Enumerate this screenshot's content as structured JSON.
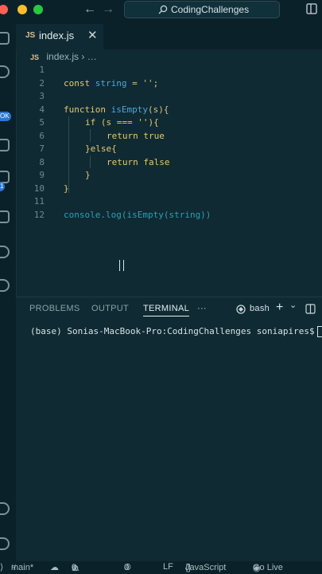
{
  "titlebar": {
    "back_icon": "arrow-left-icon",
    "forward_icon": "arrow-right-icon",
    "command_center_label": "CodingChallenges",
    "traffic_lights": [
      "#fe5f57",
      "#febc2e",
      "#28c840"
    ]
  },
  "activity_bar": {
    "badges": [
      "OK",
      "1"
    ]
  },
  "tab": {
    "lang_badge": "JS",
    "filename": "index.js",
    "close_glyph": "✕"
  },
  "breadcrumb": {
    "lang_badge": "JS",
    "file": "index.js",
    "separator": "›",
    "more": "…"
  },
  "editor": {
    "line_numbers": [
      "1",
      "2",
      "3",
      "4",
      "5",
      "6",
      "7",
      "8",
      "9",
      "10",
      "11",
      "12"
    ],
    "line2": {
      "kw": "const",
      "name": "string",
      "rest": " = '';"
    },
    "line4": {
      "kw": "function",
      "name": "isEmpty",
      "rest": "(s){"
    },
    "line5": "if (s === ''){",
    "line6": "return true",
    "line7": "}else{",
    "line8": "return false",
    "line9": "}",
    "line10": "}",
    "line12": "console.log(isEmpty(string))"
  },
  "panel": {
    "tabs": [
      "PROBLEMS",
      "OUTPUT",
      "TERMINAL"
    ],
    "active_tab": "TERMINAL",
    "more": "···",
    "shell": "bash",
    "add": "+",
    "chevron": "⌄",
    "terminal_line": "(base) Sonias-MacBook-Pro:CodingChallenges soniapires$"
  },
  "statusbar": {
    "branch": "main*",
    "errors": "0",
    "warnings": "0",
    "ports": "0",
    "eol": "LF",
    "language": "JavaScript",
    "live": "Go Live"
  }
}
